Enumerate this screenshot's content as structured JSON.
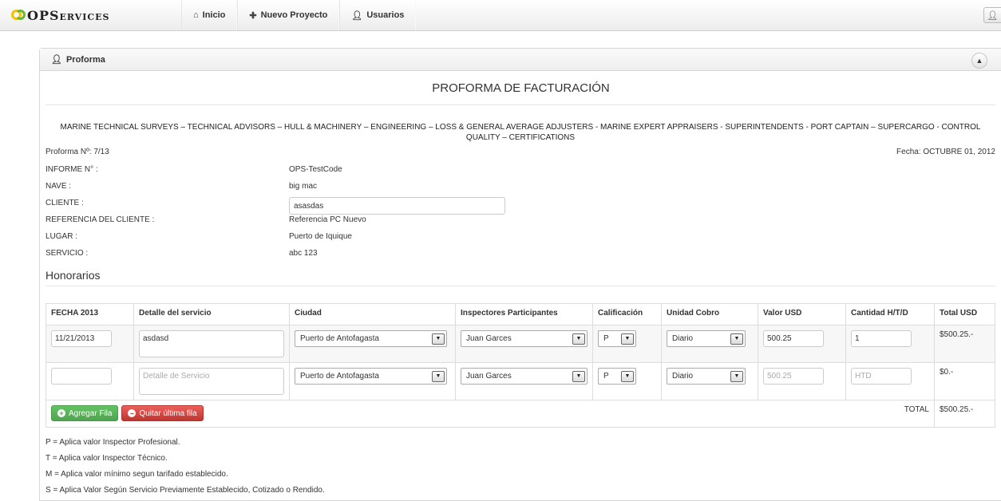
{
  "brand": {
    "name": "OPServices"
  },
  "nav": {
    "home": "Inicio",
    "new_project": "Nuevo Proyecto",
    "users": "Usuarios"
  },
  "panel": {
    "title": "Proforma",
    "doc_title": "PROFORMA DE FACTURACIÓN",
    "services": "MARINE TECHNICAL SURVEYS – TECHNICAL ADVISORS – HULL & MACHINERY – ENGINEERING – LOSS & GENERAL AVERAGE ADJUSTERS - MARINE EXPERT APPRAISERS - SUPERINTENDENTS - PORT CAPTAIN – SUPERCARGO - CONTROL QUALITY – CERTIFICATIONS",
    "proforma_no": "Proforma Nº: 7/13",
    "fecha": "Fecha: OCTUBRE 01, 2012"
  },
  "fields": {
    "informe_label": "INFORME N° :",
    "informe_value": "OPS-TestCode",
    "nave_label": "NAVE :",
    "nave_value": "big mac",
    "cliente_label": "CLIENTE :",
    "cliente_value": "asasdas",
    "referencia_label": "REFERENCIA DEL CLIENTE :",
    "referencia_value": "Referencia PC Nuevo",
    "lugar_label": "LUGAR :",
    "lugar_value": "Puerto de Iquique",
    "servicio_label": "SERVICIO :",
    "servicio_value": "abc 123"
  },
  "honorarios": {
    "title": "Honorarios",
    "headers": [
      "FECHA 2013",
      "Detalle del servicio",
      "Ciudad",
      "Inspectores Participantes",
      "Calificación",
      "Unidad Cobro",
      "Valor USD",
      "Cantidad H/T/D",
      "Total USD"
    ],
    "rows": [
      {
        "fecha": "11/21/2013",
        "detalle": "asdasd",
        "ciudad": "Puerto de Antofagasta",
        "inspector": "Juan Garces",
        "calificacion": "P",
        "unidad": "Diario",
        "valor": "500.25",
        "cantidad": "1",
        "total": "$500.25.-"
      },
      {
        "fecha": "",
        "detalle": "",
        "detalle_placeholder": "Detalle de Servicio",
        "ciudad": "Puerto de Antofagasta",
        "inspector": "Juan Garces",
        "calificacion": "P",
        "unidad": "Diario",
        "valor": "",
        "valor_placeholder": "500.25",
        "cantidad": "",
        "cantidad_placeholder": "HTD",
        "total": "$0.-"
      }
    ],
    "add_row": "Agregar Fila",
    "remove_row": "Quitar última fila",
    "total_label": "TOTAL",
    "total_value": "$500.25.-"
  },
  "legend": [
    "P = Aplica valor Inspector Profesional.",
    "T = Aplica valor Inspector Técnico.",
    "M = Aplica valor mínimo segun tarifado establecido.",
    "S = Aplica Valor Según Servicio Previamente Establecido, Cotizado o Rendido."
  ]
}
